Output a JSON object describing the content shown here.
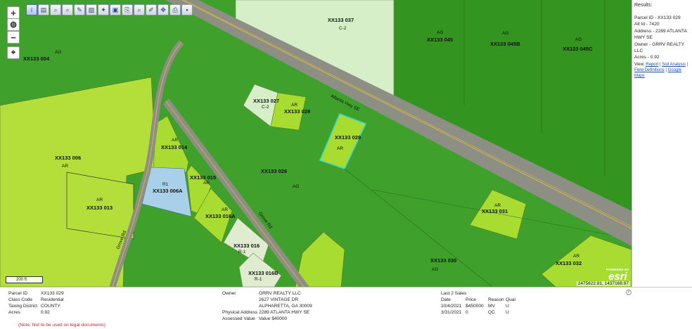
{
  "toolbar": {
    "tools": [
      "info-icon",
      "layers-icon",
      "search-icon",
      "search-zoom-icon",
      "edit-icon",
      "measure-icon",
      "star-icon",
      "select-icon",
      "export-icon",
      "zoom-area-icon",
      "draw-icon",
      "full-extent-icon",
      "print-icon",
      "save-icon"
    ],
    "glyphs": [
      "i",
      "▤",
      "⌕",
      "⌕",
      "✎",
      "▧",
      "✦",
      "▣",
      "⎘",
      "⌕",
      "✐",
      "✥",
      "⎙",
      "▪"
    ]
  },
  "zoom": {
    "in": "+",
    "globe": "◍",
    "out": "−",
    "locate": "⌖"
  },
  "scalebar": {
    "label": "200 ft"
  },
  "parcels": [
    {
      "id": "XX133 004",
      "zone": "AG"
    },
    {
      "id": "XX133 037",
      "zone": "C-2"
    },
    {
      "id": "XX133 045",
      "zone": "AG"
    },
    {
      "id": "XX133 045B",
      "zone": "AG"
    },
    {
      "id": "XX133 045C",
      "zone": "AG"
    },
    {
      "id": "XX133 027",
      "zone": "C-2"
    },
    {
      "id": "XX133 028",
      "zone": "AR"
    },
    {
      "id": "XX133 029",
      "zone": "AR"
    },
    {
      "id": "XX133 014",
      "zone": "AR"
    },
    {
      "id": "XX133 006",
      "zone": "AR"
    },
    {
      "id": "XX133 015",
      "zone": "AR"
    },
    {
      "id": "XX133 026",
      "zone": "AG"
    },
    {
      "id": "XX133 006A",
      "zone": "R1"
    },
    {
      "id": "XX133 013",
      "zone": "AR"
    },
    {
      "id": "XX133 016A",
      "zone": "AR"
    },
    {
      "id": "XX133 016",
      "zone": "R-1"
    },
    {
      "id": "XX133 016B",
      "zone": "R-1"
    },
    {
      "id": "XX133 031",
      "zone": "AR"
    },
    {
      "id": "XX133 030",
      "zone": "AG"
    },
    {
      "id": "XX133 032",
      "zone": "AR"
    }
  ],
  "roads": {
    "main": "Atlanta Hwy SE",
    "crossing": "Grove Rd",
    "left": "Grove Rd"
  },
  "map_footer": {
    "coords": "2475622.81, 1437168.97",
    "esri_powered": "POWERED BY",
    "esri_logo": "esri"
  },
  "results": {
    "header": "Results:",
    "parcel_id": "Parcel ID - XX133 029",
    "alt_id": "Alt Id - 7420",
    "address": "Address - 2289 ATLANTA HWY SE",
    "owner": "Owner - GRRV REALTY LLC",
    "acres": "Acres - 0.92",
    "view_label": "View:",
    "links": [
      "Report",
      "Soil Analysis",
      "Field Definitions",
      "Google Maps"
    ]
  },
  "info": {
    "parcel_id_label": "Parcel ID",
    "parcel_id": "XX133 029",
    "class_code_label": "Class Code",
    "class_code": "Residential",
    "taxing_district_label": "Taxing District",
    "taxing_district": "COUNTY",
    "acres_label": "Acres",
    "acres": "0.92",
    "owner_label": "Owner",
    "owner_name": "GRRV REALTY LLC",
    "owner_addr1": "2627 VINTAGE DR",
    "owner_addr2": "ALPHARETTA, GA 30009",
    "physical_address_label": "Physical Address",
    "physical_address": "2289 ATLANTA HWY SE",
    "assessed_value_label": "Assessed Value",
    "assessed_value": "Value $40000",
    "sales_title": "Last 2 Sales",
    "sales_headers": [
      "Date",
      "Price",
      "Reason",
      "Qual"
    ],
    "sales": [
      [
        "10/4/2021",
        "$450000",
        "MV",
        "U"
      ],
      [
        "3/31/2021",
        "0",
        "QC",
        "U"
      ]
    ],
    "note": "(Note: Not to be used on legal documents)"
  },
  "colors": {
    "ag": "#3fa02c",
    "ar": "#a9dc30",
    "c2": "#d8f0c8",
    "r1": "#a8d0e8",
    "r1b": "#e0ecd0",
    "selected": "#3ad8c8"
  }
}
